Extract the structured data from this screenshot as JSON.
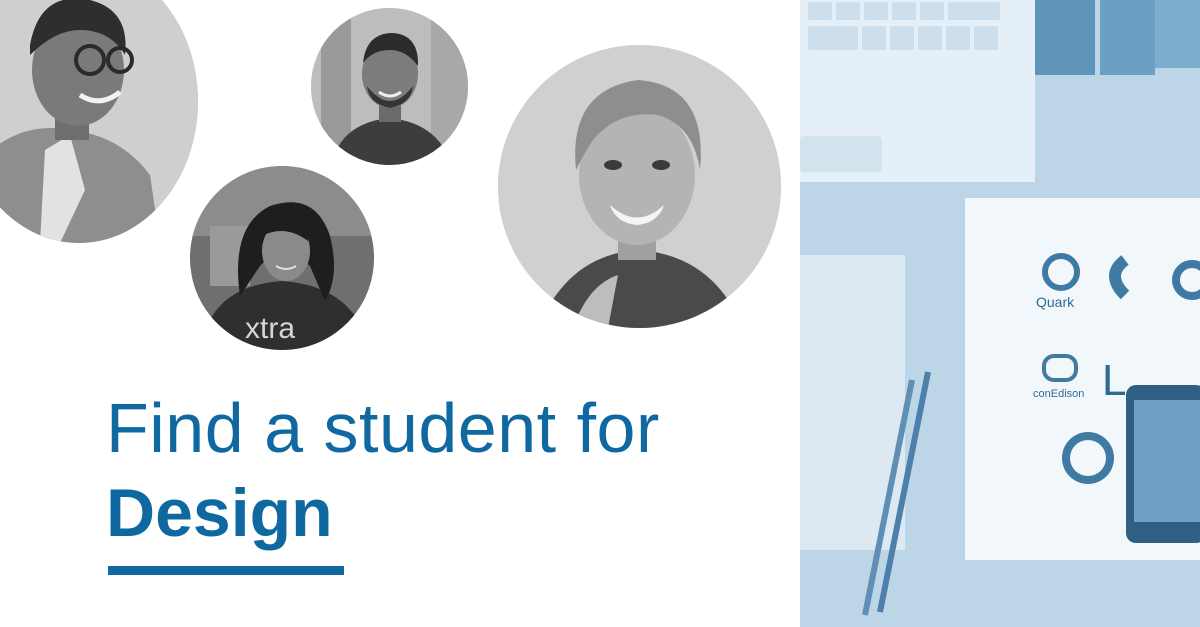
{
  "headline": {
    "line1": "Find a student for",
    "subject": "Design"
  },
  "colors": {
    "brand": "#0f68a0",
    "photo_tint": "#b9d3e6"
  },
  "people": [
    {
      "name": "student-avatar-1",
      "icon": "person-photo"
    },
    {
      "name": "student-avatar-2",
      "icon": "person-photo"
    },
    {
      "name": "student-avatar-3",
      "icon": "person-photo"
    },
    {
      "name": "student-avatar-4",
      "icon": "person-photo"
    }
  ],
  "desk_photo": {
    "logos": [
      "Quark",
      "conEdison"
    ]
  }
}
